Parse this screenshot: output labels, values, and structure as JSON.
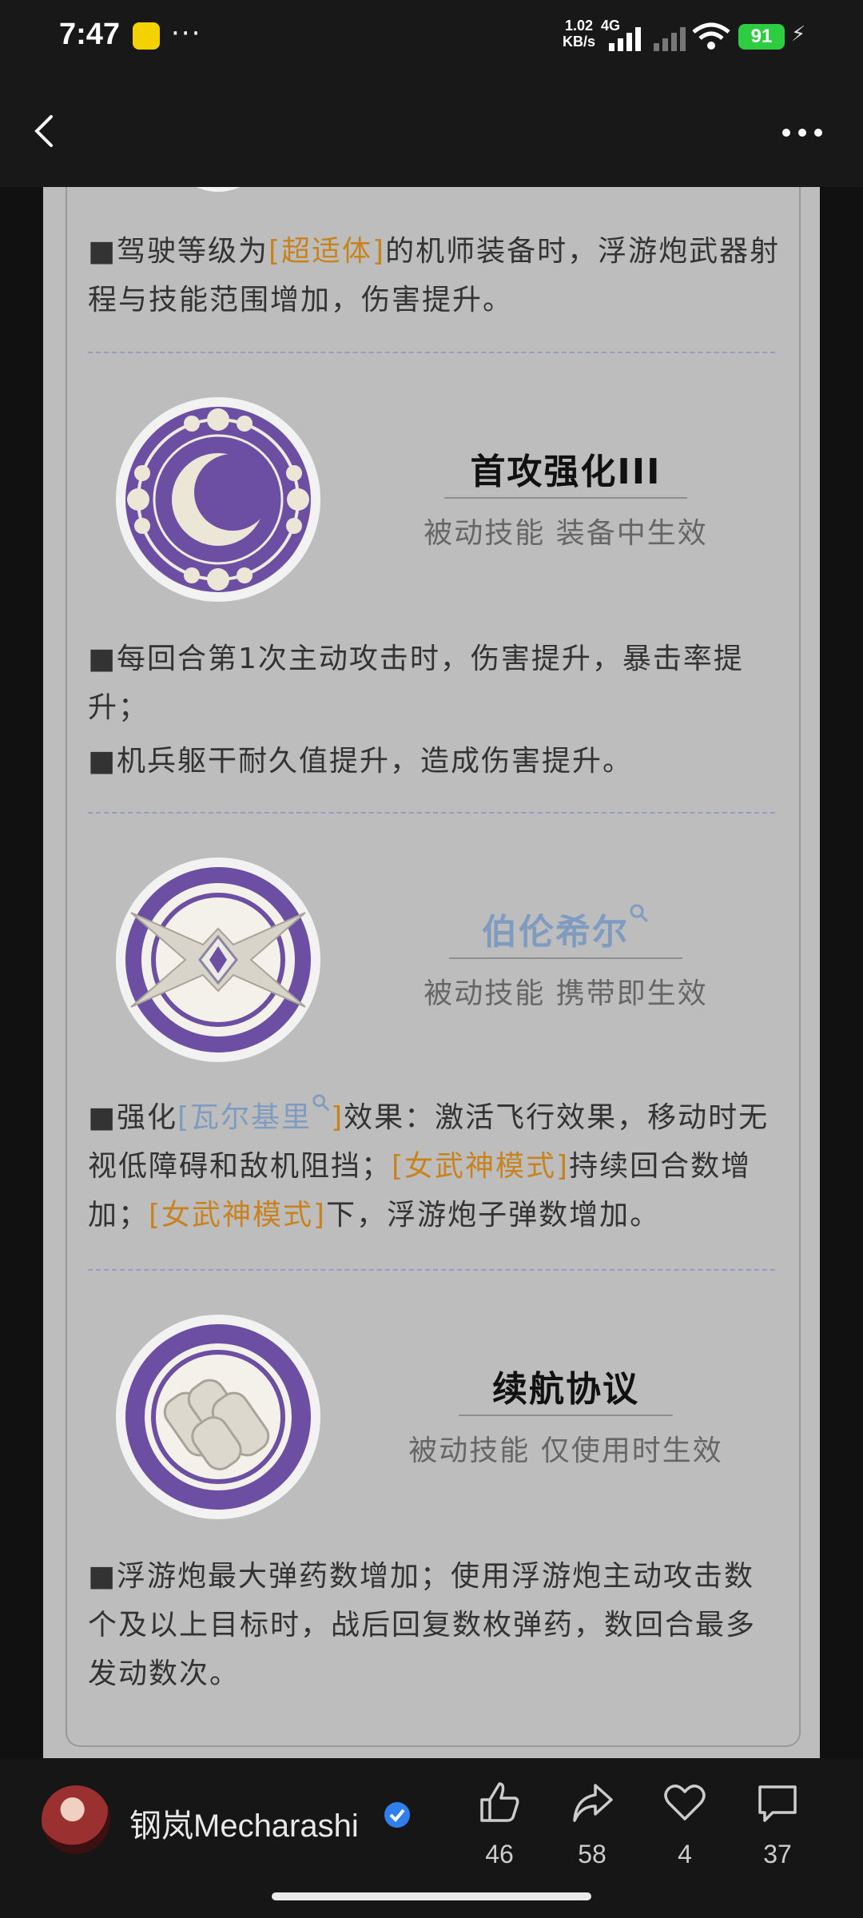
{
  "status_bar": {
    "time": "7:47",
    "more": "···",
    "net_speed_value": "1.02",
    "net_speed_unit": "KB/s",
    "network": "4G",
    "battery": "91"
  },
  "article": {
    "top_text": {
      "prefix": "■驾驶等级为",
      "highlight": "[超适体]",
      "suffix": "的机师装备时，浮游炮武器射程与技能范围增加，伤害提升。"
    },
    "skills": [
      {
        "title": "首攻强化III",
        "subtitle": "被动技能 装备中生效",
        "desc_line1": "■每回合第1次主动攻击时，伤害提升，暴击率提升；",
        "desc_line2": "■机兵躯干耐久值提升，造成伤害提升。"
      },
      {
        "title": "伯伦希尔",
        "subtitle": "被动技能 携带即生效",
        "desc_part1": "■强化",
        "desc_link": "[瓦尔基里",
        "desc_link_end": "]",
        "desc_part2": "效果：激活飞行效果，移动时无视低障碍和敌机阻挡；",
        "desc_hl1": "[女武神模式]",
        "desc_part3": "持续回合数增加；",
        "desc_hl2": "[女武神模式]",
        "desc_part4": "下，浮游炮子弹数增加。"
      },
      {
        "title": "续航协议",
        "subtitle": "被动技能 仅使用时生效",
        "desc_line1": "■浮游炮最大弹药数增加；使用浮游炮主动攻击数个及以上目标时，战后回复数枚弹药，数回合最多发动数次。"
      }
    ]
  },
  "bottom_bar": {
    "author": "钢岚Mecharashi",
    "likes": "46",
    "shares": "58",
    "favorites": "4",
    "comments": "37"
  },
  "colors": {
    "highlight": "#c8821e",
    "link": "#7f9cc0",
    "icon_purple": "#6c4fa3",
    "page_bg": "#bdbdbd"
  }
}
